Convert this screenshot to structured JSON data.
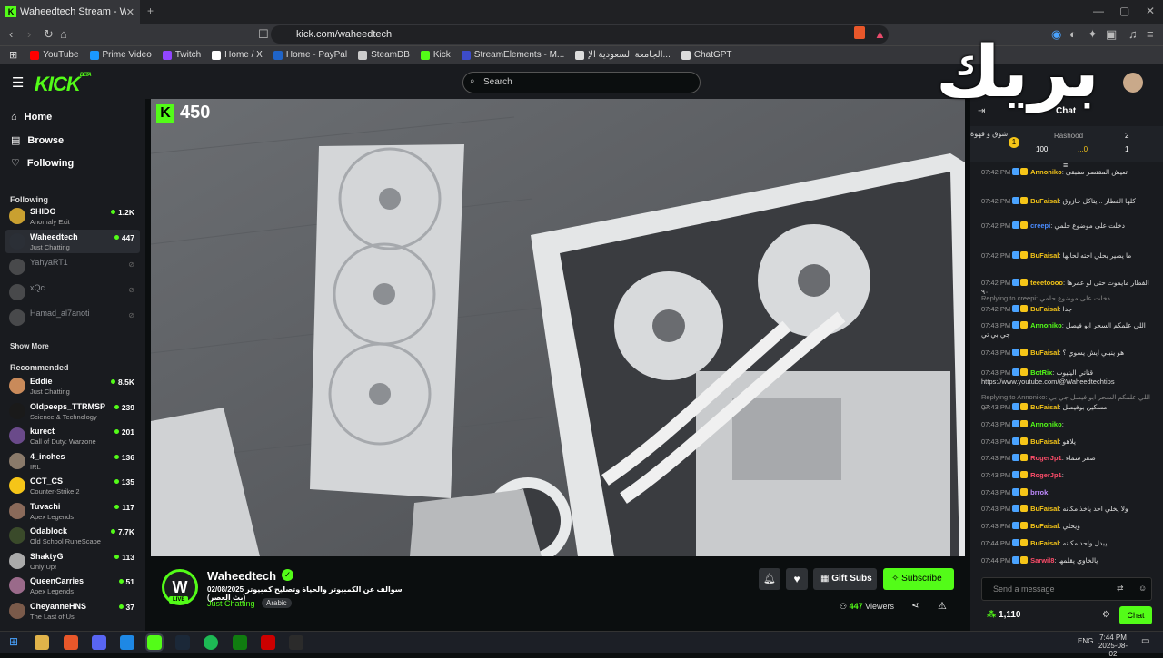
{
  "browser": {
    "tab_title": "Waheedtech Stream - Watch",
    "url": "kick.com/waheedtech",
    "bookmarks": [
      {
        "label": "YouTube",
        "color": "#ff0000"
      },
      {
        "label": "Prime Video",
        "color": "#1a98ff"
      },
      {
        "label": "Twitch",
        "color": "#9146ff"
      },
      {
        "label": "Home / X",
        "color": "#ffffff"
      },
      {
        "label": "Home - PayPal",
        "color": "#1f64c8"
      },
      {
        "label": "SteamDB",
        "color": "#cccccc"
      },
      {
        "label": "Kick",
        "color": "#53fc18"
      },
      {
        "label": "StreamElements - M...",
        "color": "#3d4cc9"
      },
      {
        "label": "الجامعة السعودية الإ...",
        "color": "#dddddd"
      },
      {
        "label": "ChatGPT",
        "color": "#dddddd"
      }
    ]
  },
  "header": {
    "logo": "KICK",
    "logo_tag": "BETA",
    "search_placeholder": "Search"
  },
  "sidebar": {
    "nav": [
      "Home",
      "Browse",
      "Following"
    ],
    "following_title": "Following",
    "following": [
      {
        "name": "SHIDO",
        "category": "Anomaly Exit",
        "viewers": "1.2K",
        "live": true
      },
      {
        "name": "Waheedtech",
        "category": "Just Chatting",
        "viewers": "447",
        "live": true
      },
      {
        "name": "YahyaRT1",
        "category": "",
        "viewers": "",
        "live": false
      },
      {
        "name": "xQc",
        "category": "",
        "viewers": "",
        "live": false
      },
      {
        "name": "Hamad_al7anoti",
        "category": "",
        "viewers": "",
        "live": false
      }
    ],
    "show_more": "Show More",
    "recommended_title": "Recommended",
    "recommended": [
      {
        "name": "Eddie",
        "category": "Just Chatting",
        "viewers": "8.5K"
      },
      {
        "name": "Oldpeeps_TTRMSP",
        "category": "Science & Technology",
        "viewers": "239"
      },
      {
        "name": "kurect",
        "category": "Call of Duty: Warzone",
        "viewers": "201"
      },
      {
        "name": "4_inches",
        "category": "IRL",
        "viewers": "136"
      },
      {
        "name": "CCT_CS",
        "category": "Counter-Strike 2",
        "viewers": "135"
      },
      {
        "name": "Tuvachi",
        "category": "Apex Legends",
        "viewers": "117"
      },
      {
        "name": "Odablock",
        "category": "Old School RuneScape",
        "viewers": "7.7K"
      },
      {
        "name": "ShaktyG",
        "category": "Only Up!",
        "viewers": "113"
      },
      {
        "name": "QueenCarries",
        "category": "Apex Legends",
        "viewers": "51"
      },
      {
        "name": "CheyanneHNS",
        "category": "The Last of Us",
        "viewers": "37"
      }
    ]
  },
  "video": {
    "overlay_count": "450"
  },
  "stream": {
    "channel": "Waheedtech",
    "title": "سوالف عن الكمبيوتر والحياة وتصليح كمبيوتر 02/08/2025 (بث العصر)",
    "category": "Just Chatting",
    "tag": "Arabic",
    "live_badge": "LIVE",
    "viewers": "447",
    "viewers_label": "Viewers",
    "gift_subs": "Gift Subs",
    "subscribe": "Subscribe"
  },
  "chat": {
    "title": "Chat",
    "overlay_text": "بريك",
    "pinned_text": "شوق و قهوة",
    "pinned_count": "100",
    "leaderboard": [
      {
        "name": "Rashood",
        "value": "2"
      },
      {
        "name": "...0",
        "value": "1"
      }
    ],
    "messages": [
      {
        "time": "07:42 PM",
        "user": "Annoniko",
        "text": "تعيش المقتصر سنبقى",
        "color": "#f5c518"
      },
      {
        "time": "07:42 PM",
        "user": "BuFaisal",
        "text": "كلها الفطار .. يتاكل خازوق",
        "color": "#f5c518"
      },
      {
        "time": "07:42 PM",
        "user": "creepi",
        "text": "دخلت على موضوع حلمي",
        "color": "#4a8cff"
      },
      {
        "time": "07:42 PM",
        "user": "BuFaisal",
        "text": "ما يصير يحلي اخته لحالها",
        "color": "#f5c518"
      },
      {
        "time": "07:42 PM",
        "user": "teeetoooo",
        "text": "الفطار مايموت حتى لو عمرها ٩٠",
        "color": "#f5c518"
      },
      {
        "time": "",
        "user": "Replying to creepi",
        "text": "دخلت على موضوع حلمي",
        "color": "#888888"
      },
      {
        "time": "07:42 PM",
        "user": "BuFaisal",
        "text": "جدا",
        "color": "#f5c518"
      },
      {
        "time": "07:43 PM",
        "user": "Annoniko",
        "text": "اللي علمكم السحر ابو فيصل جي بي تي",
        "color": "#53fc18"
      },
      {
        "time": "07:43 PM",
        "user": "BuFaisal",
        "text": "هو ينبني ايش يسوي ؟",
        "color": "#f5c518"
      },
      {
        "time": "07:43 PM",
        "user": "BotRix",
        "text": "قناتي اليتيوب https://www.youtube.com/@Waheedtechtips",
        "color": "#53fc18"
      },
      {
        "time": "",
        "user": "Replying to Annoniko",
        "text": "اللي علمكم السحر ابو فيصل جي بي تي",
        "color": "#888888"
      },
      {
        "time": "07:43 PM",
        "user": "BuFaisal",
        "text": "مسكين بوفيصل",
        "color": "#f5c518"
      },
      {
        "time": "07:43 PM",
        "user": "Annoniko",
        "text": "",
        "color": "#53fc18"
      },
      {
        "time": "07:43 PM",
        "user": "BuFaisal",
        "text": "يلاهو",
        "color": "#f5c518"
      },
      {
        "time": "07:43 PM",
        "user": "RogerJp1",
        "text": "صفر سماء",
        "color": "#ff4d6a"
      },
      {
        "time": "07:43 PM",
        "user": "RogerJp1",
        "text": "",
        "color": "#ff4d6a"
      },
      {
        "time": "07:43 PM",
        "user": "brrok",
        "text": "",
        "color": "#c08aff"
      },
      {
        "time": "07:43 PM",
        "user": "BuFaisal",
        "text": "ولا يخلي احد ياخذ مكانه",
        "color": "#f5c518"
      },
      {
        "time": "07:43 PM",
        "user": "BuFaisal",
        "text": "ويخلي",
        "color": "#f5c518"
      },
      {
        "time": "07:44 PM",
        "user": "BuFaisal",
        "text": "يبدل واحد مكانه",
        "color": "#f5c518"
      },
      {
        "time": "07:44 PM",
        "user": "Sarwil8",
        "text": "يالخاوي يقلمها",
        "color": "#ff4d6a"
      }
    ],
    "input_placeholder": "Send a message",
    "points": "1,110",
    "chat_button": "Chat"
  },
  "taskbar": {
    "lang": "ENG",
    "time": "7:44 PM",
    "date": "2025-08-02"
  }
}
